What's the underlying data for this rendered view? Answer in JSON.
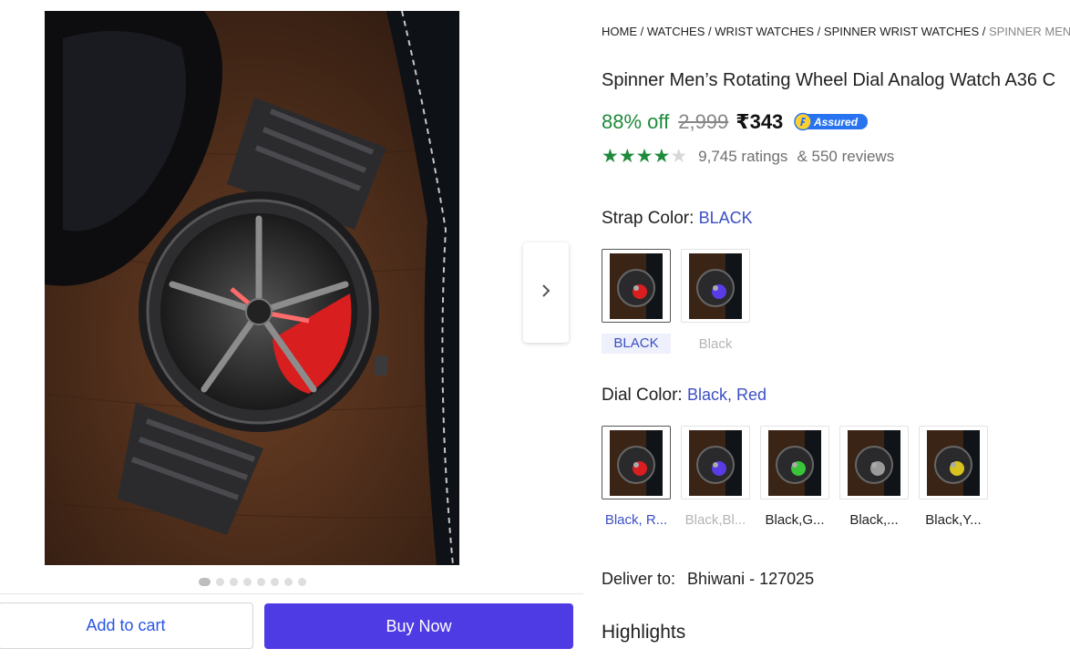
{
  "gallery": {
    "image_alt": "watch-product-image",
    "dot_count": 8,
    "active_dot": 0
  },
  "actions": {
    "add_to_cart": "Add to cart",
    "buy_now": "Buy Now"
  },
  "breadcrumb": {
    "items": [
      "HOME",
      "WATCHES",
      "WRIST WATCHES",
      "SPINNER WRIST WATCHES"
    ],
    "separator": " / ",
    "current": "SPINNER MEN'S R"
  },
  "product": {
    "title": "Spinner Men’s Rotating Wheel Dial Analog Watch A36 C",
    "discount": "88% off",
    "mrp": "2,999",
    "price": "₹343",
    "assured_label": "Assured",
    "rating_stars": 4,
    "ratings_text": "9,745 ratings",
    "reviews_text": "& 550 reviews"
  },
  "strap": {
    "label": "Strap Color:",
    "value": "BLACK",
    "options": [
      {
        "label": "BLACK",
        "state": "selected",
        "accent": "#d81e1e"
      },
      {
        "label": "Black",
        "state": "unavailable",
        "accent": "#5a3be8"
      }
    ]
  },
  "dial": {
    "label": "Dial Color:",
    "value": "Black, Red",
    "options": [
      {
        "label": "Black, R...",
        "state": "selected",
        "accent": "#d81e1e"
      },
      {
        "label": "Black,Bl...",
        "state": "unavailable",
        "accent": "#5a3be8"
      },
      {
        "label": "Black,G...",
        "state": "available",
        "accent": "#39c439"
      },
      {
        "label": "Black,...",
        "state": "available",
        "accent": "#9a9a9a"
      },
      {
        "label": "Black,Y...",
        "state": "available",
        "accent": "#d8c21e"
      }
    ]
  },
  "delivery": {
    "label": "Deliver to:",
    "location": "Bhiwani - 127025"
  },
  "highlights": {
    "title": "Highlights"
  },
  "colors": {
    "brand_blue": "#4f3be4",
    "link_blue": "#2a55e5",
    "discount_green": "#1f8a3b",
    "assured_blue": "#2874f0",
    "assured_yellow": "#ffcf2f"
  }
}
